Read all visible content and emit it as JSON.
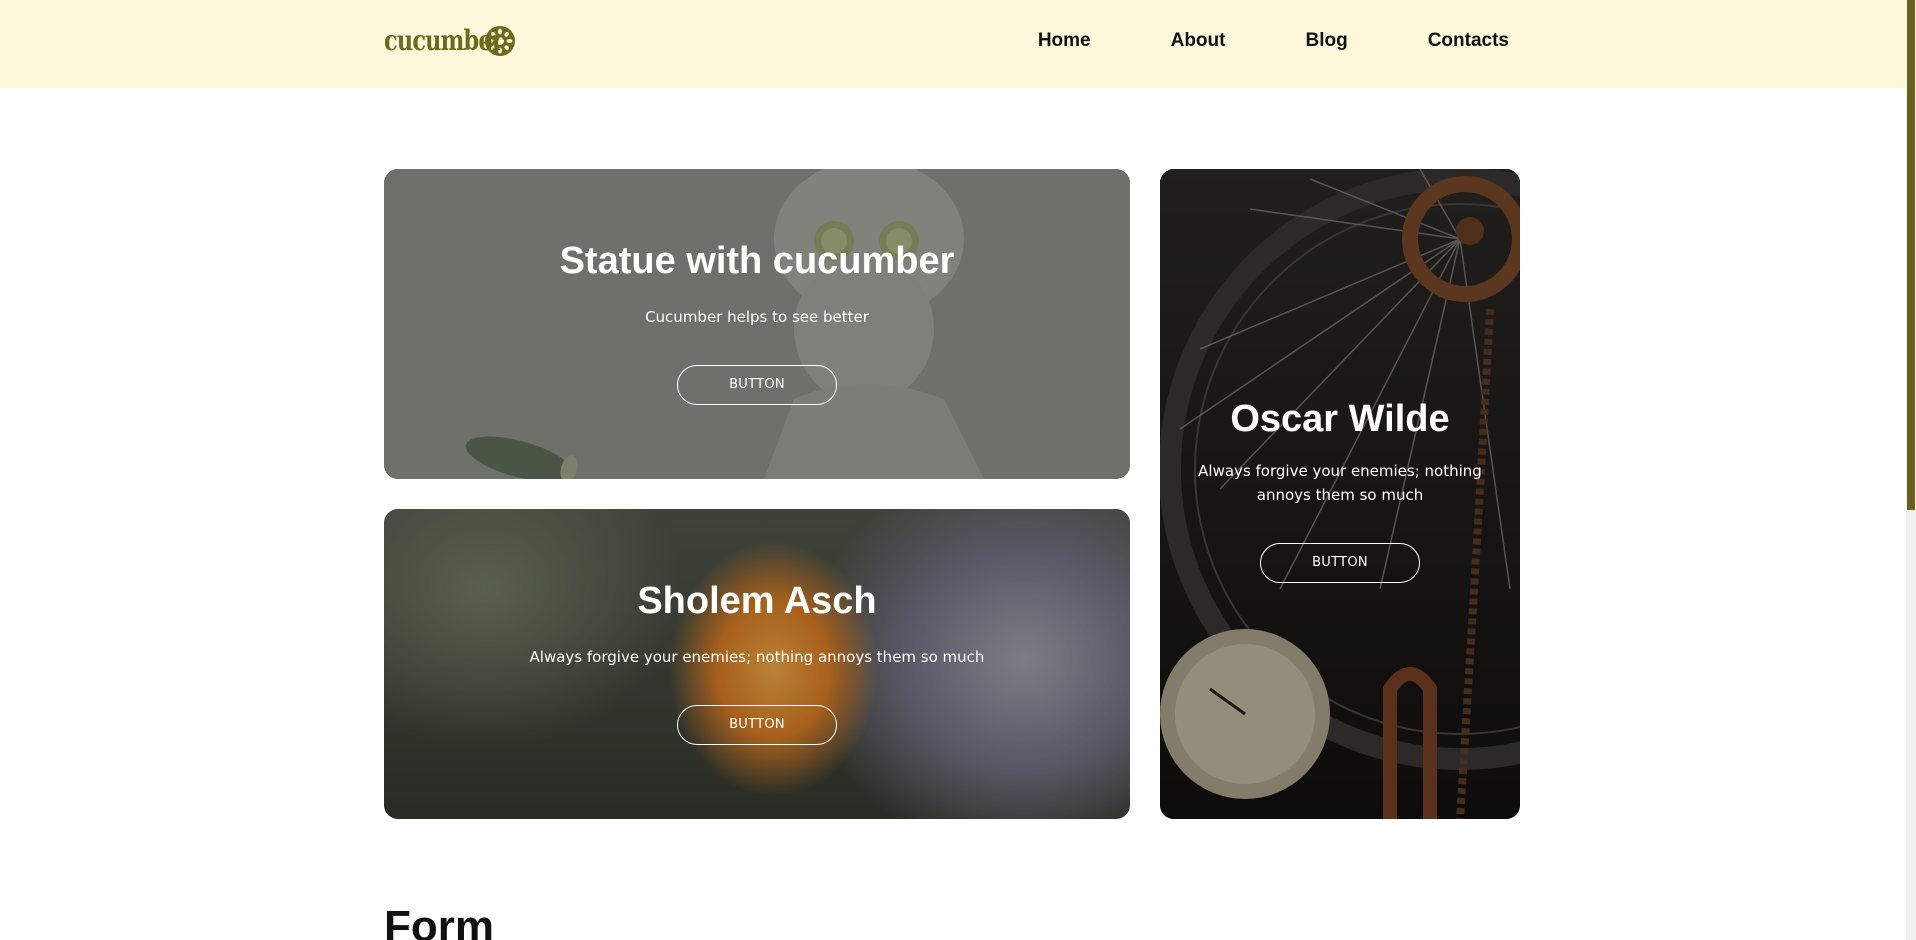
{
  "header": {
    "logo_text": "cucumber",
    "nav": [
      "Home",
      "About",
      "Blog",
      "Contacts"
    ]
  },
  "cards": [
    {
      "title": "Statue with cucumber",
      "text": "Cucumber helps to see better",
      "button": "BUTTON"
    },
    {
      "title": "Sholem Asch",
      "text": "Always forgive your enemies; nothing annoys them so much",
      "button": "BUTTON"
    },
    {
      "title": "Oscar Wilde",
      "text": "Always forgive your enemies; nothing annoys them so much",
      "button": "BUTTON"
    }
  ],
  "form": {
    "title": "Form"
  },
  "colors": {
    "header_bg": "#fef9dc",
    "logo": "#6a6b1c",
    "scrollbar_thumb": "#6b5f1c"
  }
}
